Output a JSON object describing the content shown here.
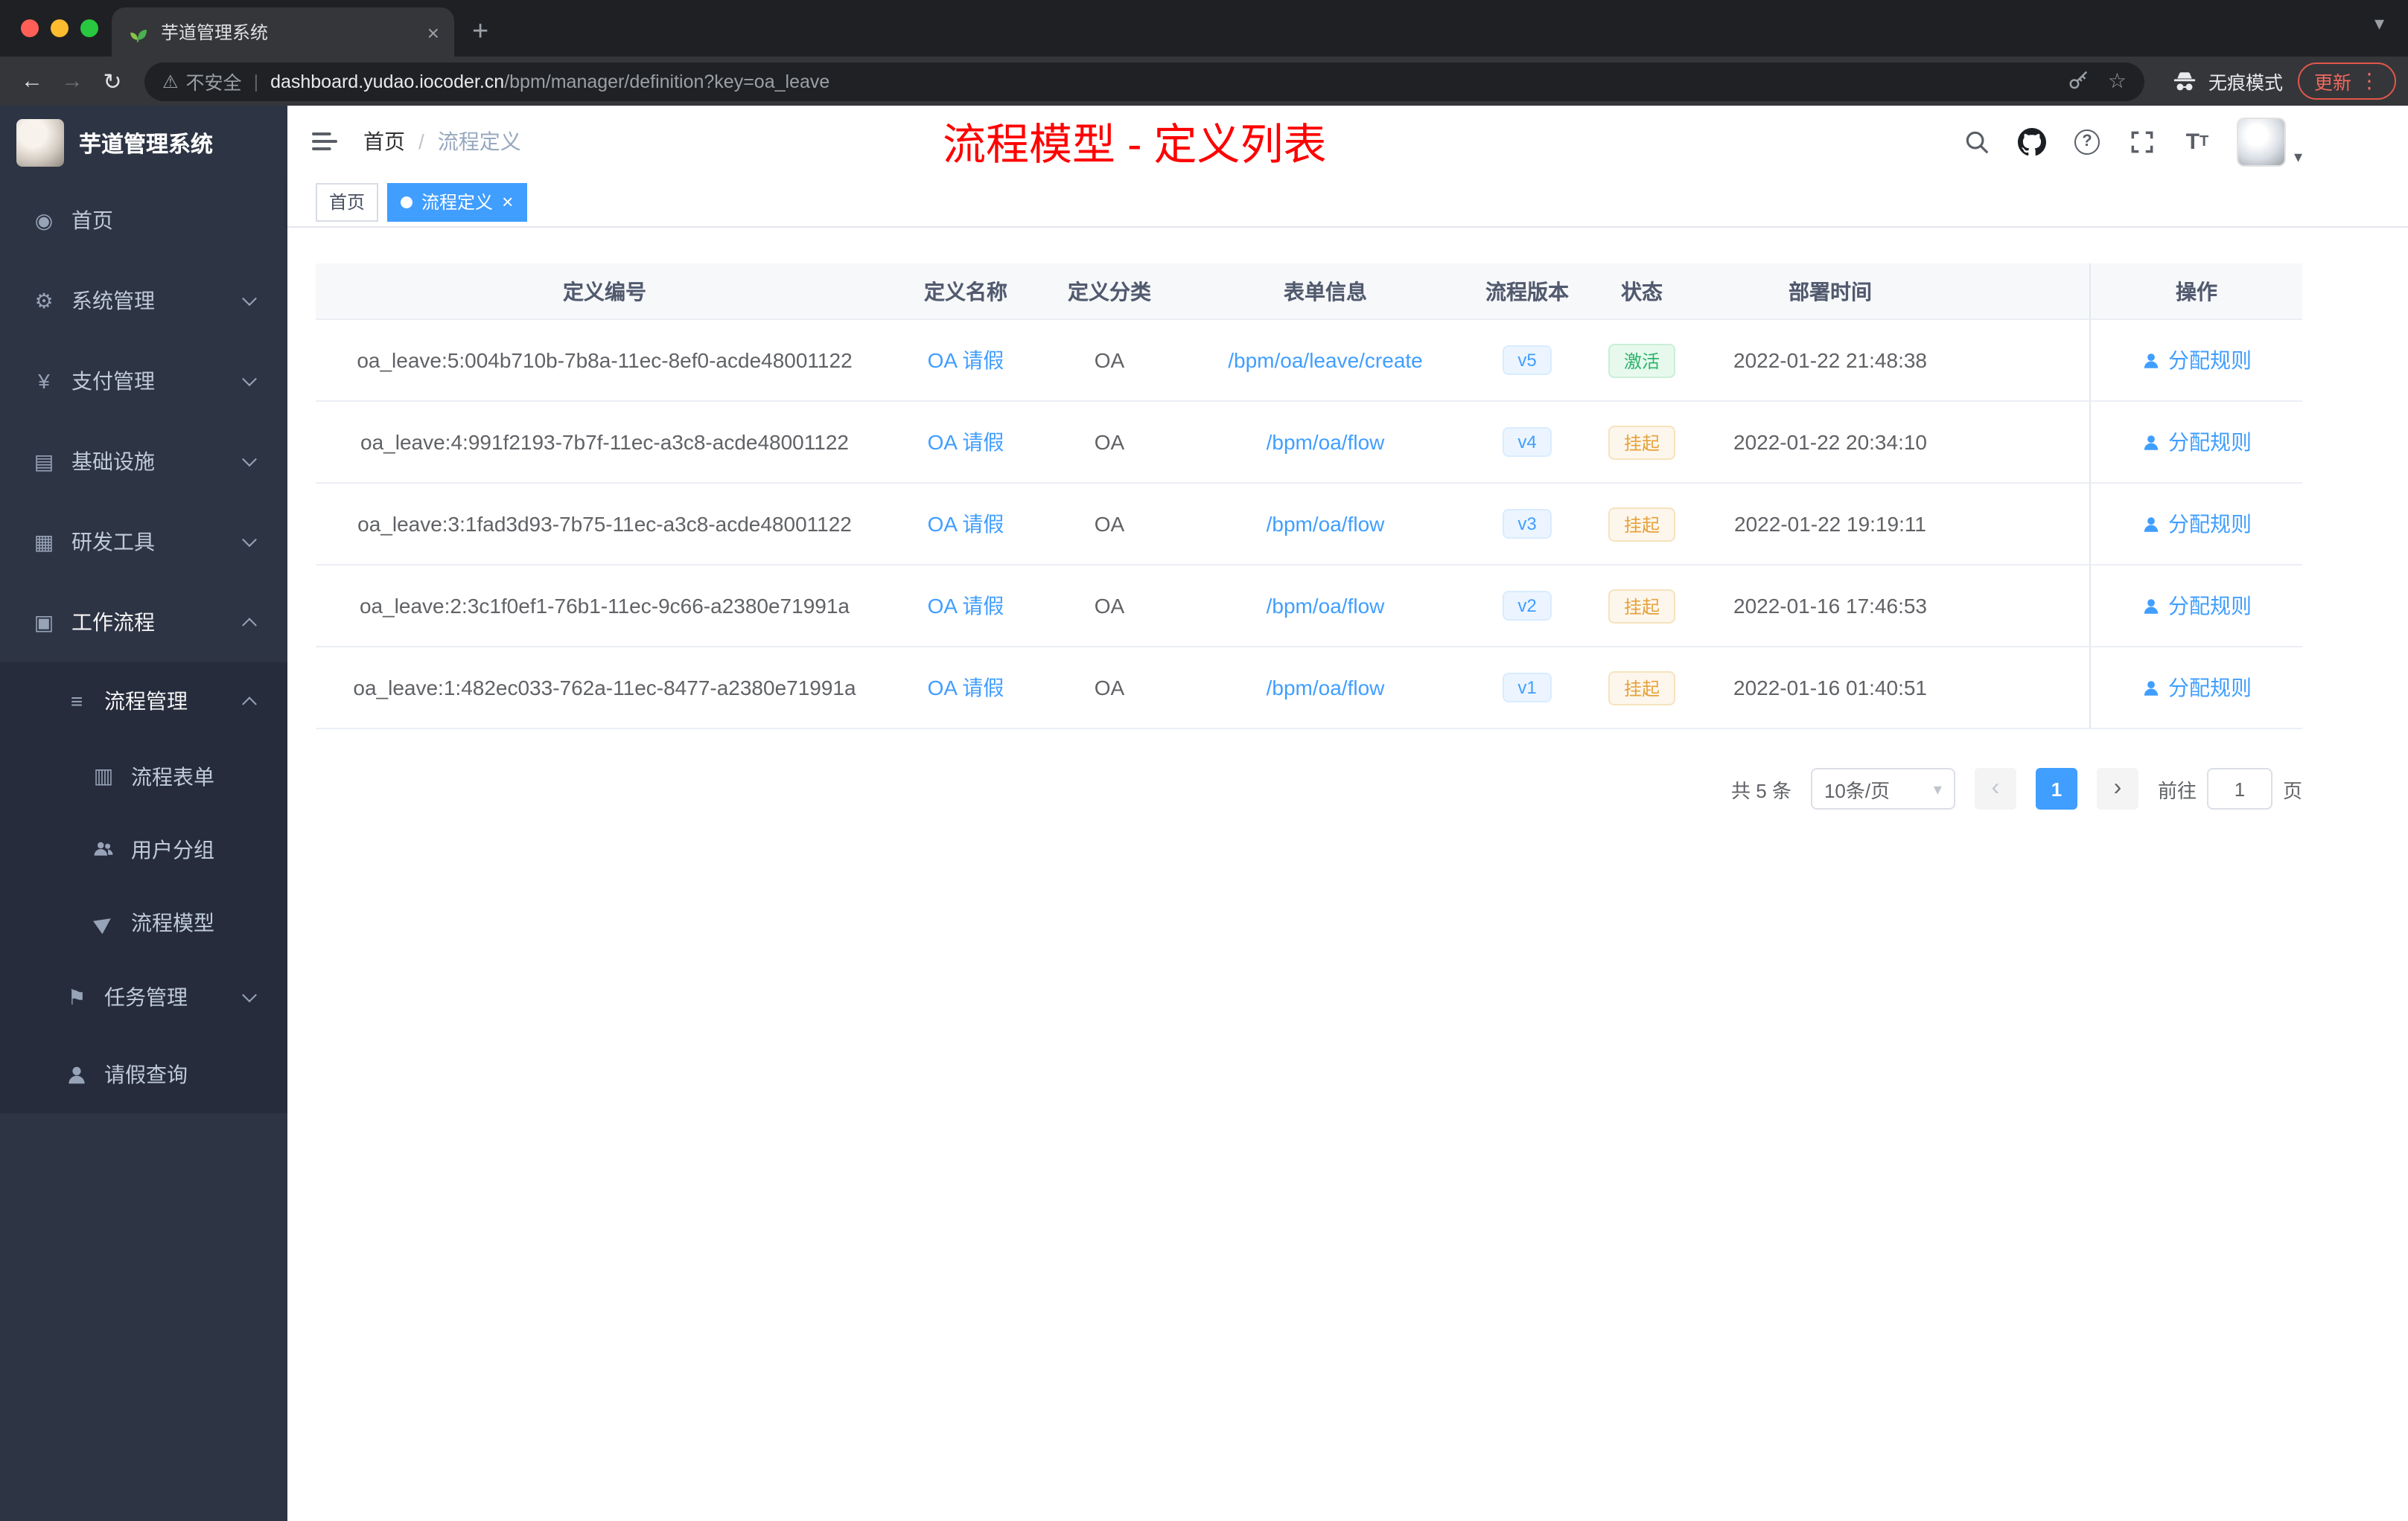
{
  "browser": {
    "tab_title": "芋道管理系统",
    "security_label": "不安全",
    "url_host": "dashboard.yudao.iocoder.cn",
    "url_path": "/bpm/manager/definition?key=oa_leave",
    "incognito_label": "无痕模式",
    "update_label": "更新"
  },
  "sidebar": {
    "logo_title": "芋道管理系统",
    "items": [
      {
        "label": "首页",
        "icon": "dashboard-icon",
        "level": 1
      },
      {
        "label": "系统管理",
        "icon": "gear-icon",
        "level": 1,
        "chevron": "down"
      },
      {
        "label": "支付管理",
        "icon": "payment-icon",
        "level": 1,
        "chevron": "down"
      },
      {
        "label": "基础设施",
        "icon": "infrastructure-icon",
        "level": 1,
        "chevron": "down"
      },
      {
        "label": "研发工具",
        "icon": "devtools-icon",
        "level": 1,
        "chevron": "down"
      },
      {
        "label": "工作流程",
        "icon": "workflow-icon",
        "level": 1,
        "chevron": "up",
        "expanded": true
      },
      {
        "label": "流程管理",
        "icon": "process-management-icon",
        "level": 2,
        "chevron": "up",
        "expanded": true
      },
      {
        "label": "流程表单",
        "icon": "form-icon",
        "level": 3
      },
      {
        "label": "用户分组",
        "icon": "user-group-icon",
        "level": 3
      },
      {
        "label": "流程模型",
        "icon": "process-model-icon",
        "level": 3
      },
      {
        "label": "任务管理",
        "icon": "task-management-icon",
        "level": 2,
        "chevron": "down"
      },
      {
        "label": "请假查询",
        "icon": "leave-query-icon",
        "level": 2
      }
    ]
  },
  "header": {
    "breadcrumb": {
      "home": "首页",
      "separator": "/",
      "current": "流程定义"
    },
    "page_title": "流程模型 - 定义列表"
  },
  "tags": {
    "items": [
      {
        "label": "首页",
        "active": false
      },
      {
        "label": "流程定义",
        "active": true,
        "closable": true
      }
    ]
  },
  "table": {
    "columns": [
      "定义编号",
      "定义名称",
      "定义分类",
      "表单信息",
      "流程版本",
      "状态",
      "部署时间",
      "操作"
    ],
    "rows": [
      {
        "id": "oa_leave:5:004b710b-7b8a-11ec-8ef0-acde48001122",
        "name": "OA 请假",
        "category": "OA",
        "form": "/bpm/oa/leave/create",
        "version": "v5",
        "status": "激活",
        "status_type": "success",
        "time": "2022-01-22 21:48:38",
        "action": "分配规则"
      },
      {
        "id": "oa_leave:4:991f2193-7b7f-11ec-a3c8-acde48001122",
        "name": "OA 请假",
        "category": "OA",
        "form": "/bpm/oa/flow",
        "version": "v4",
        "status": "挂起",
        "status_type": "warning",
        "time": "2022-01-22 20:34:10",
        "action": "分配规则"
      },
      {
        "id": "oa_leave:3:1fad3d93-7b75-11ec-a3c8-acde48001122",
        "name": "OA 请假",
        "category": "OA",
        "form": "/bpm/oa/flow",
        "version": "v3",
        "status": "挂起",
        "status_type": "warning",
        "time": "2022-01-22 19:19:11",
        "action": "分配规则"
      },
      {
        "id": "oa_leave:2:3c1f0ef1-76b1-11ec-9c66-a2380e71991a",
        "name": "OA 请假",
        "category": "OA",
        "form": "/bpm/oa/flow",
        "version": "v2",
        "status": "挂起",
        "status_type": "warning",
        "time": "2022-01-16 17:46:53",
        "action": "分配规则"
      },
      {
        "id": "oa_leave:1:482ec033-762a-11ec-8477-a2380e71991a",
        "name": "OA 请假",
        "category": "OA",
        "form": "/bpm/oa/flow",
        "version": "v1",
        "status": "挂起",
        "status_type": "warning",
        "time": "2022-01-16 01:40:51",
        "action": "分配规则"
      }
    ]
  },
  "pagination": {
    "total_label": "共 5 条",
    "page_size_label": "10条/页",
    "current_page": "1",
    "goto_label": "前往",
    "goto_value": "1",
    "page_unit_label": "页"
  },
  "colors": {
    "accent": "#409eff",
    "success": "#2bb36b",
    "warning": "#e6a23c",
    "title_red": "#ff0000",
    "sidebar_bg": "#2d3444",
    "submenu_bg": "#262c3b"
  }
}
